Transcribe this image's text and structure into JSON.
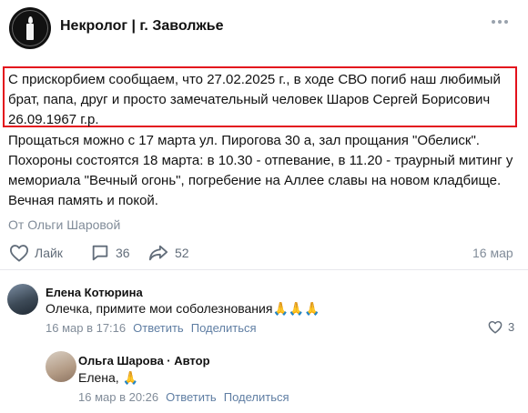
{
  "header": {
    "title": "Некролог | г. Заволжье"
  },
  "post": {
    "highlight_text": "С прискорбием сообщаем, что 27.02.2025 г., в ходе СВО погиб наш любимый брат, папа, друг и просто замечательный человек Шаров Сергей Борисович 26.09.1967 г.р.",
    "body_text": "Прощаться можно с 17 марта ул. Пирогова 30 а, зал прощания \"Обелиск\". Похороны состоятся 18 марта: в 10.30 - отпевание, в 11.20 - траурный митинг у мемориала \"Вечный огонь\", погребение на Аллее славы на новом кладбище. Вечная память и покой.",
    "author": "От Ольги Шаровой",
    "like_label": "Лайк",
    "comments_count": "36",
    "shares_count": "52",
    "date": "16 мар"
  },
  "comments": [
    {
      "name": "Елена Котюрина",
      "text": "Олечка, примите мои соболезнования",
      "emoji": "🙏🙏🙏",
      "time": "16 мар в 17:16",
      "reply_label": "Ответить",
      "share_label": "Поделиться",
      "likes": "3"
    },
    {
      "name": "Ольга Шарова · Автор",
      "text": "Елена,",
      "emoji": "🙏",
      "time": "16 мар в 20:26",
      "reply_label": "Ответить",
      "share_label": "Поделиться"
    }
  ],
  "colors": {
    "highlight_border": "#e3111c",
    "link": "#5f7ea3",
    "muted": "#818c99",
    "icon": "#626d7a"
  },
  "icons": [
    "more-icon",
    "heart-icon",
    "comment-icon",
    "share-icon",
    "heart-icon"
  ]
}
